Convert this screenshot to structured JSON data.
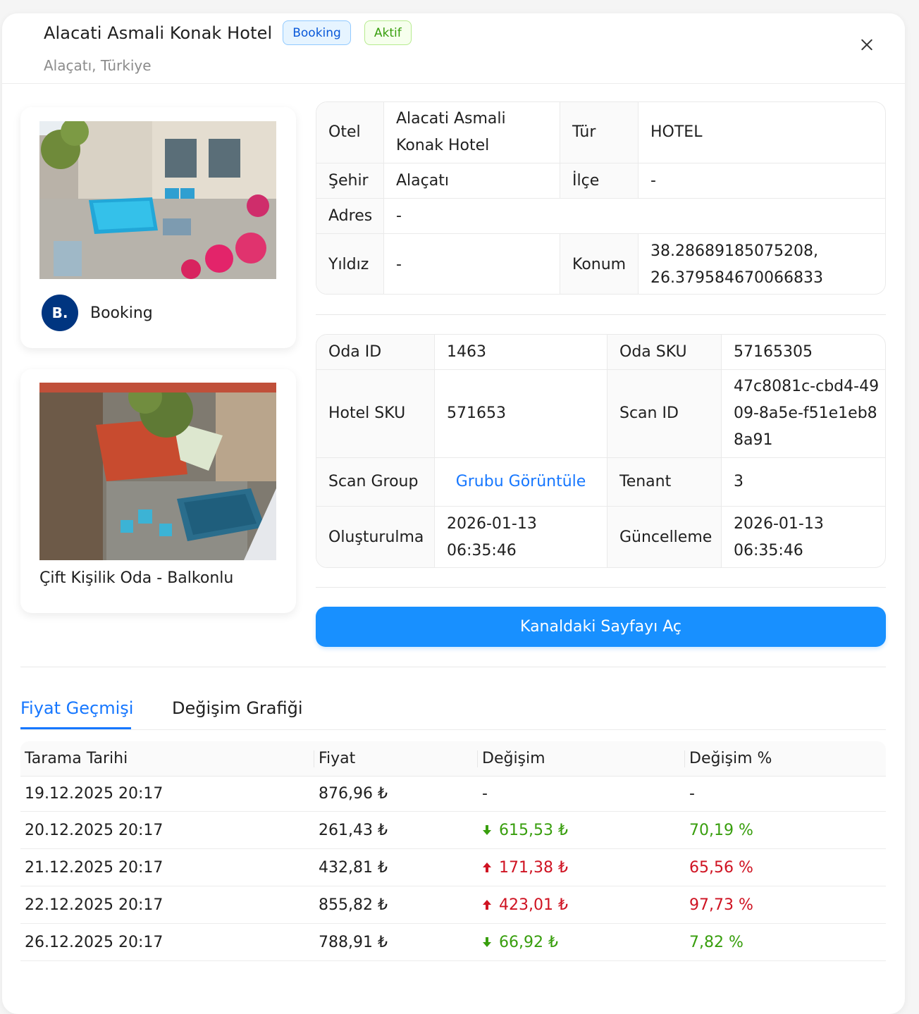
{
  "header": {
    "title": "Alacati Asmali Konak Hotel",
    "channel_tag": "Booking",
    "status_tag": "Aktif",
    "subtitle": "Alaçatı, Türkiye"
  },
  "channel": {
    "logo_text": "B.",
    "name": "Booking"
  },
  "room": {
    "name": "Çift Kişilik Oda - Balkonlu"
  },
  "hotel_info": {
    "otel_label": "Otel",
    "otel_value": "Alacati Asmali Konak Hotel",
    "tur_label": "Tür",
    "tur_value": "HOTEL",
    "sehir_label": "Şehir",
    "sehir_value": "Alaçatı",
    "ilce_label": "İlçe",
    "ilce_value": "-",
    "adres_label": "Adres",
    "adres_value": "-",
    "yildiz_label": "Yıldız",
    "yildiz_value": "-",
    "konum_label": "Konum",
    "konum_value": "38.28689185075208, 26.379584670066833"
  },
  "room_info": {
    "oda_id_label": "Oda ID",
    "oda_id_value": "1463",
    "oda_sku_label": "Oda SKU",
    "oda_sku_value": "57165305",
    "hotel_sku_label": "Hotel SKU",
    "hotel_sku_value": "571653",
    "scan_id_label": "Scan ID",
    "scan_id_value": "47c8081c-cbd4-4909-8a5e-f51e1eb88a91",
    "scan_group_label": "Scan Group",
    "scan_group_link": "Grubu Görüntüle",
    "tenant_label": "Tenant",
    "tenant_value": "3",
    "olusturulma_label": "Oluşturulma",
    "olusturulma_value": "2026-01-13 06:35:46",
    "guncelleme_label": "Güncelleme",
    "guncelleme_value": "2026-01-13 06:35:46"
  },
  "open_button": "Kanaldaki Sayfayı Aç",
  "tabs": [
    {
      "label": "Fiyat Geçmişi",
      "active": true
    },
    {
      "label": "Değişim Grafiği",
      "active": false
    }
  ],
  "price_table": {
    "columns": [
      "Tarama Tarihi",
      "Fiyat",
      "Değişim",
      "Değişim %"
    ],
    "rows": [
      {
        "date": "19.12.2025 20:17",
        "price": "876,96 ₺",
        "change": "-",
        "change_pct": "-",
        "direction": "none"
      },
      {
        "date": "20.12.2025 20:17",
        "price": "261,43 ₺",
        "change": "615,53 ₺",
        "change_pct": "70,19 %",
        "direction": "down"
      },
      {
        "date": "21.12.2025 20:17",
        "price": "432,81 ₺",
        "change": "171,38 ₺",
        "change_pct": "65,56 %",
        "direction": "up"
      },
      {
        "date": "22.12.2025 20:17",
        "price": "855,82 ₺",
        "change": "423,01 ₺",
        "change_pct": "97,73 %",
        "direction": "up"
      },
      {
        "date": "26.12.2025 20:17",
        "price": "788,91 ₺",
        "change": "66,92 ₺",
        "change_pct": "7,82 %",
        "direction": "down"
      }
    ]
  },
  "colors": {
    "primary": "#1890ff",
    "link": "#1677ff",
    "increase": "#cf1322",
    "decrease": "#389e0d",
    "booking_brand": "#003580"
  }
}
